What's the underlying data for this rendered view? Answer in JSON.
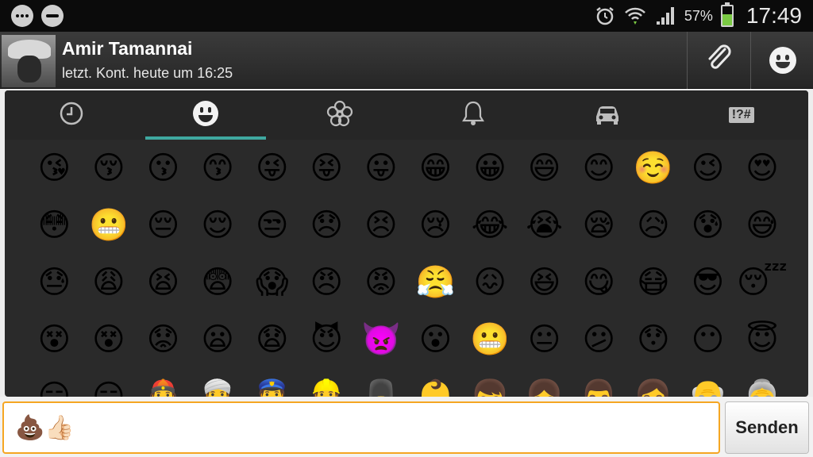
{
  "status_bar": {
    "battery_percent": "57%",
    "battery_level": 0.57,
    "time": "17:49",
    "icons": [
      "more-icon",
      "blocked-icon",
      "alarm-icon",
      "wifi-icon",
      "signal-icon",
      "battery-icon"
    ]
  },
  "conversation": {
    "contact_name": "Amir Tamannai",
    "last_seen": "letzt. Kont. heute um 16:25"
  },
  "actions": {
    "attach_icon": "paperclip-icon",
    "emoji_icon": "smiley-icon"
  },
  "emoji_panel": {
    "tabs": [
      {
        "name": "recent",
        "icon": "clock-icon",
        "active": false
      },
      {
        "name": "people",
        "icon": "smiley-icon",
        "active": true
      },
      {
        "name": "nature",
        "icon": "flower-icon",
        "active": false
      },
      {
        "name": "objects",
        "icon": "bell-icon",
        "active": false
      },
      {
        "name": "places",
        "icon": "car-icon",
        "active": false
      },
      {
        "name": "symbols",
        "icon": "symbols-icon",
        "label": "!?#",
        "active": false
      }
    ],
    "emojis": [
      "😘",
      "😚",
      "😗",
      "😙",
      "😜",
      "😝",
      "😛",
      "😁",
      "😀",
      "😄",
      "😊",
      "☺️",
      "😉",
      "😍",
      "😳",
      "😬",
      "😔",
      "😌",
      "😒",
      "😞",
      "😣",
      "😢",
      "😂",
      "😭",
      "😪",
      "😥",
      "😰",
      "😅",
      "😓",
      "😩",
      "😫",
      "😨",
      "😱",
      "😠",
      "😡",
      "😤",
      "😖",
      "😆",
      "😋",
      "😷",
      "😎",
      "😴",
      "😵",
      "😵",
      "😟",
      "😦",
      "😧",
      "😈",
      "👿",
      "😮",
      "😬",
      "😐",
      "😕",
      "😯",
      "😶",
      "😇",
      "😏",
      "😑",
      "👲",
      "👳",
      "👮",
      "👷",
      "💂",
      "👶",
      "👦",
      "👧",
      "👨",
      "👩",
      "👴",
      "👵"
    ]
  },
  "composer": {
    "message": "💩👍🏻",
    "send_label": "Senden",
    "accent_color": "#f5a623"
  }
}
